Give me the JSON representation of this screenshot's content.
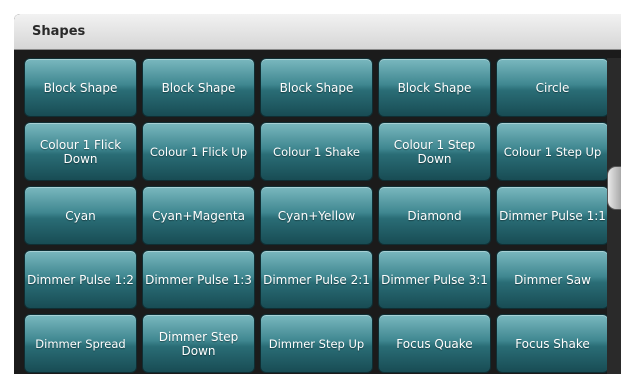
{
  "window": {
    "title": "Shapes"
  },
  "buttons": [
    "Block Shape",
    "Block Shape",
    "Block Shape",
    "Block Shape",
    "Circle",
    "Colour 1 Flick Down",
    "Colour 1 Flick Up",
    "Colour 1 Shake",
    "Colour 1 Step Down",
    "Colour 1 Step Up",
    "Cyan",
    "Cyan+Magenta",
    "Cyan+Yellow",
    "Diamond",
    "Dimmer Pulse 1:1",
    "Dimmer Pulse 1:2",
    "Dimmer Pulse 1:3",
    "Dimmer Pulse 2:1",
    "Dimmer Pulse 3:1",
    "Dimmer Saw",
    "Dimmer Spread",
    "Dimmer Step Down",
    "Dimmer Step Up",
    "Focus Quake",
    "Focus Shake"
  ],
  "colors": {
    "button_top": "#7ab8bf",
    "button_bottom": "#184c54",
    "window_bg": "#1b1b1b"
  }
}
